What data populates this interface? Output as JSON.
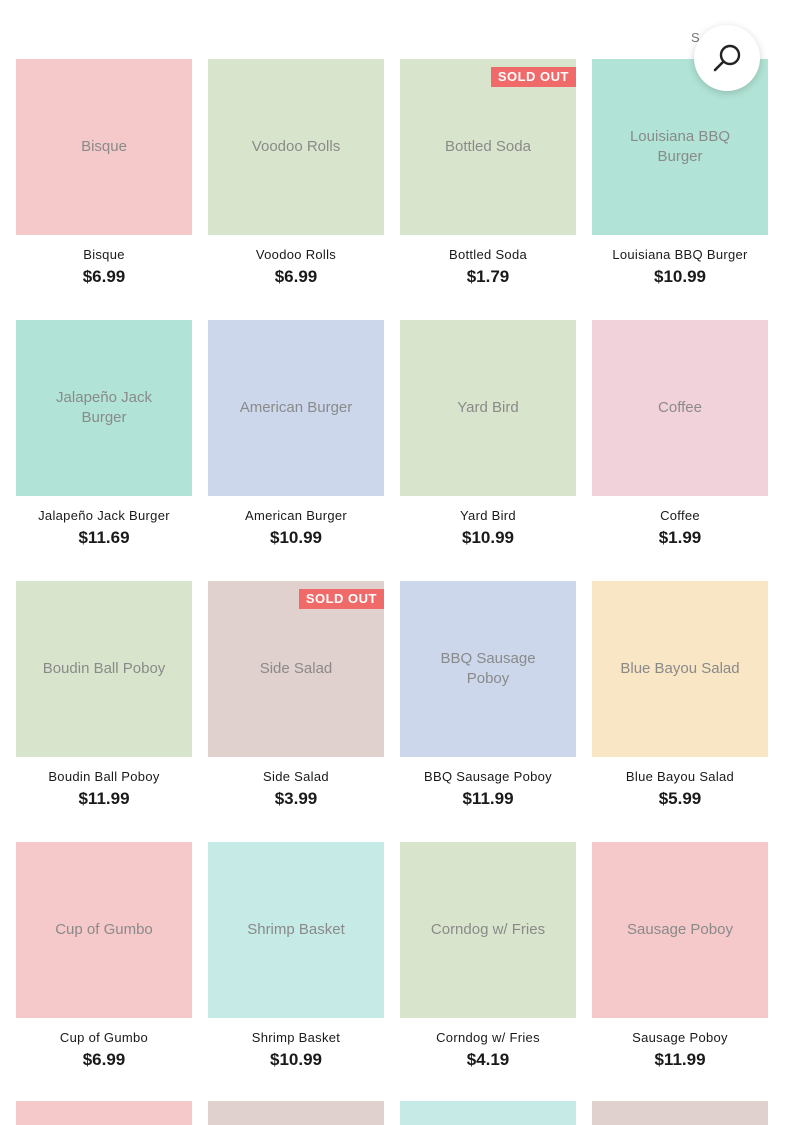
{
  "sort": {
    "label": "S"
  },
  "colors": {
    "pink": "#f5c8ca",
    "green": "#d9e4cc",
    "mint": "#b1e4d6",
    "blue": "#ccd7eb",
    "rose": "#f2d2da",
    "taupe": "#e0d0ce",
    "cream": "#f8e6c5",
    "aqua": "#c6eae6",
    "badge": "#f06a6a"
  },
  "products": [
    {
      "name": "Bisque",
      "price": "$6.99",
      "thumb_label": "Bisque",
      "color": "#f5c8ca",
      "badge": ""
    },
    {
      "name": "Voodoo Rolls",
      "price": "$6.99",
      "thumb_label": "Voodoo Rolls",
      "color": "#d9e4cc",
      "badge": ""
    },
    {
      "name": "Bottled Soda",
      "price": "$1.79",
      "thumb_label": "Bottled Soda",
      "color": "#d9e4cc",
      "badge": "SOLD OUT"
    },
    {
      "name": "Louisiana BBQ Burger",
      "price": "$10.99",
      "thumb_label": "Louisiana BBQ Burger",
      "color": "#b1e4d6",
      "badge": ""
    },
    {
      "name": "Jalapeño Jack Burger",
      "price": "$11.69",
      "thumb_label": "Jalapeño Jack Burger",
      "color": "#b1e4d6",
      "badge": ""
    },
    {
      "name": "American Burger",
      "price": "$10.99",
      "thumb_label": "American Burger",
      "color": "#ccd7eb",
      "badge": ""
    },
    {
      "name": "Yard Bird",
      "price": "$10.99",
      "thumb_label": "Yard Bird",
      "color": "#d9e4cc",
      "badge": ""
    },
    {
      "name": "Coffee",
      "price": "$1.99",
      "thumb_label": "Coffee",
      "color": "#f2d2da",
      "badge": ""
    },
    {
      "name": "Boudin Ball Poboy",
      "price": "$11.99",
      "thumb_label": "Boudin Ball Poboy",
      "color": "#d9e4cc",
      "badge": ""
    },
    {
      "name": "Side Salad",
      "price": "$3.99",
      "thumb_label": "Side Salad",
      "color": "#e0d0ce",
      "badge": "SOLD OUT"
    },
    {
      "name": "BBQ Sausage Poboy",
      "price": "$11.99",
      "thumb_label": "BBQ Sausage Poboy",
      "color": "#ccd7eb",
      "badge": ""
    },
    {
      "name": "Blue Bayou Salad",
      "price": "$5.99",
      "thumb_label": "Blue Bayou Salad",
      "color": "#f8e6c5",
      "badge": ""
    },
    {
      "name": "Cup of Gumbo",
      "price": "$6.99",
      "thumb_label": "Cup of Gumbo",
      "color": "#f5c8ca",
      "badge": ""
    },
    {
      "name": "Shrimp Basket",
      "price": "$10.99",
      "thumb_label": "Shrimp Basket",
      "color": "#c6eae6",
      "badge": ""
    },
    {
      "name": "Corndog w/ Fries",
      "price": "$4.19",
      "thumb_label": "Corndog w/ Fries",
      "color": "#d9e4cc",
      "badge": ""
    },
    {
      "name": "Sausage Poboy",
      "price": "$11.99",
      "thumb_label": "Sausage Poboy",
      "color": "#f5c8ca",
      "badge": ""
    }
  ],
  "partial_row_colors": [
    "#f5c8ca",
    "#e0d0ce",
    "#c6eae6",
    "#e0d0ce"
  ],
  "icons": {
    "search": "search-icon",
    "sort_chevron": "chevron-down-icon"
  }
}
